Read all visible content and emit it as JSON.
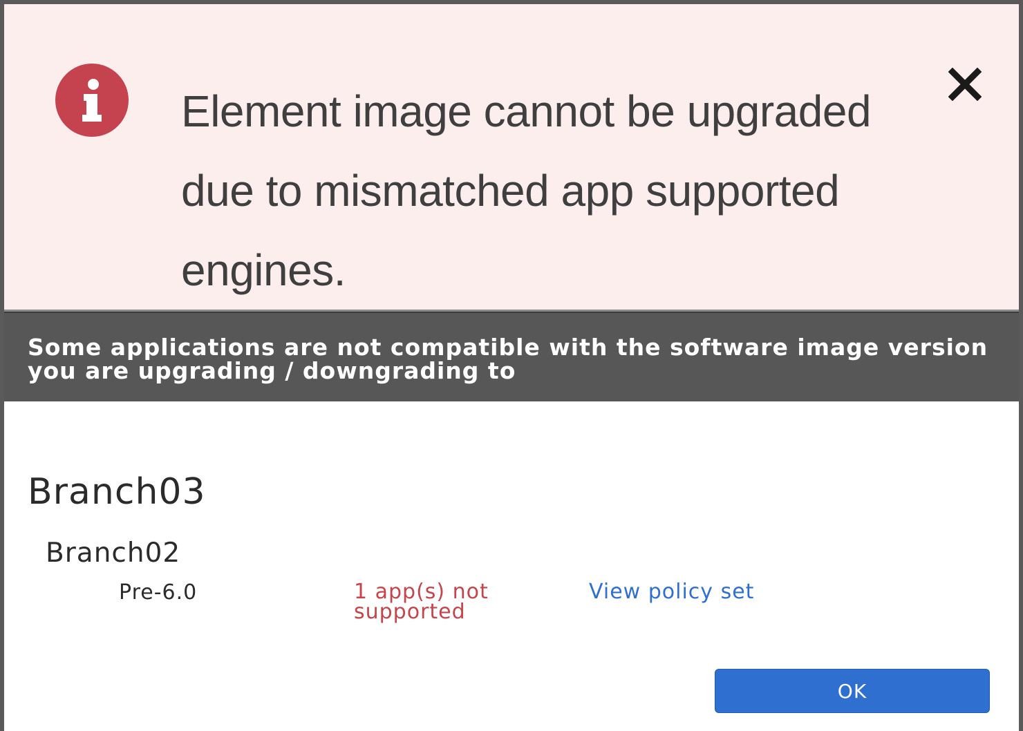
{
  "alert": {
    "icon": "info-icon",
    "message": "Element image cannot be upgraded due to mismatched app supported engines.",
    "close_icon": "close-icon",
    "background_color": "#fdeeee",
    "icon_color": "#c4434f"
  },
  "banner": {
    "text": "Some applications are not compatible with the software image version you are upgrading / downgrading to",
    "background_color": "#575757"
  },
  "site": {
    "name": "Branch03",
    "device": {
      "name": "Branch02",
      "version": "Pre-6.0",
      "status": "1 app(s) not supported",
      "status_color": "#c5454b",
      "link": "View policy set",
      "link_color": "#2f6fd0"
    }
  },
  "actions": {
    "ok_label": "OK",
    "ok_color": "#2f6fcf"
  }
}
